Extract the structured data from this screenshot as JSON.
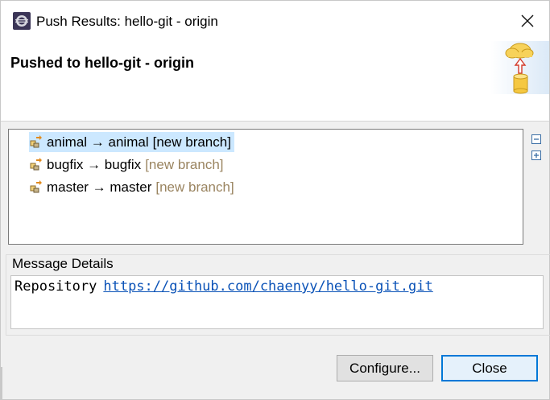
{
  "window": {
    "title": "Push Results: hello-git - origin",
    "icon": "eclipse-icon"
  },
  "header": {
    "title": "Pushed to hello-git - origin",
    "image": "cloud-upload-database-icon"
  },
  "results": [
    {
      "label": "animal → animal",
      "status": "[new branch]",
      "icon": "push-ref-icon",
      "selected": true
    },
    {
      "label": "bugfix → bugfix",
      "status": "[new branch]",
      "icon": "push-ref-icon",
      "selected": false
    },
    {
      "label": "master → master",
      "status": "[new branch]",
      "icon": "push-ref-icon",
      "selected": false
    }
  ],
  "tree_controls": {
    "collapse_icon": "collapse-all-icon",
    "expand_icon": "expand-all-icon"
  },
  "details": {
    "label": "Message Details",
    "repo_label": "Repository",
    "repo_url": "https://github.com/chaenyy/hello-git.git"
  },
  "buttons": {
    "configure": "Configure...",
    "close": "Close"
  },
  "colors": {
    "selection": "#cce8ff",
    "status_text": "#9a8460",
    "link": "#0a52b7",
    "default_button_border": "#0078d7"
  }
}
